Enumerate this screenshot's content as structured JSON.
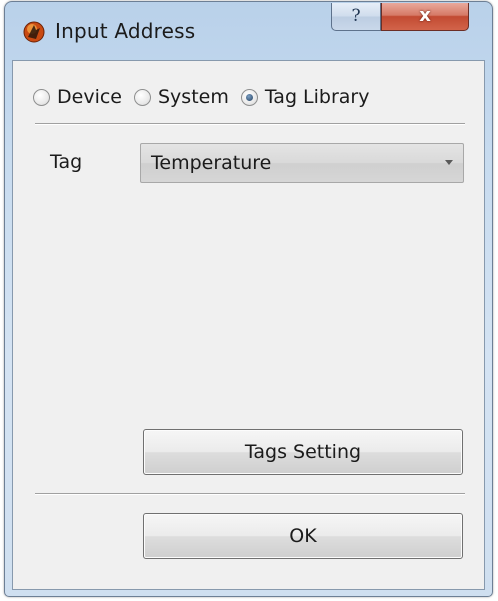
{
  "window": {
    "title": "Input Address",
    "help_label": "?",
    "close_label": "x"
  },
  "source": {
    "options": [
      {
        "label": "Device",
        "checked": false
      },
      {
        "label": "System",
        "checked": false
      },
      {
        "label": "Tag Library",
        "checked": true
      }
    ]
  },
  "tag": {
    "label": "Tag",
    "selected_value": "Temperature"
  },
  "buttons": {
    "tags_setting": "Tags Setting",
    "ok": "OK"
  },
  "colors": {
    "title_gradient": "#b9d1ea",
    "close_red": "#c24a32",
    "panel": "#f0f0f0"
  }
}
